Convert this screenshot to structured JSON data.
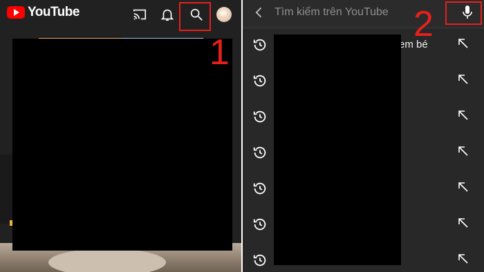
{
  "left": {
    "logo_text": "YouTube",
    "icons": [
      "cast-icon",
      "notification-bell-icon",
      "search-icon",
      "account-avatar"
    ],
    "step_label": "1"
  },
  "right": {
    "search_placeholder": "Tìm kiếm trên YouTube",
    "step_label": "2",
    "history": [
      {
        "text": "em bé"
      },
      {
        "text": ""
      },
      {
        "text": ""
      },
      {
        "text": ""
      },
      {
        "text": ""
      },
      {
        "text": ""
      },
      {
        "text": ""
      }
    ]
  },
  "colors": {
    "highlight": "#e8201c",
    "youtube_red": "#ff0000",
    "dark_bg": "#212121",
    "search_bg": "#282828"
  }
}
